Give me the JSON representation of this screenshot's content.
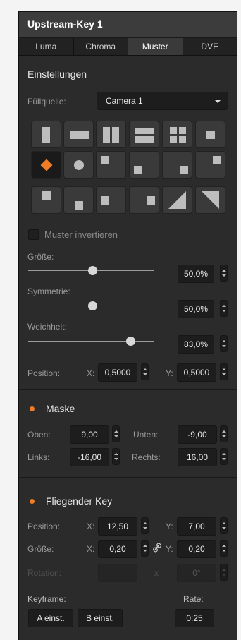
{
  "title": "Upstream-Key 1",
  "tabs": [
    {
      "label": "Luma"
    },
    {
      "label": "Chroma"
    },
    {
      "label": "Muster"
    },
    {
      "label": "DVE"
    }
  ],
  "settings": {
    "heading": "Einstellungen",
    "fill_source_label": "Füllquelle:",
    "fill_source_value": "Camera 1",
    "invert_label": "Muster invertieren",
    "invert_checked": false,
    "size": {
      "label": "Größe:",
      "value": "50,0%",
      "level": 0.5
    },
    "symmetry": {
      "label": "Symmetrie:",
      "value": "50,0%",
      "level": 0.5
    },
    "softness": {
      "label": "Weichheit:",
      "value": "83,0%",
      "level": 0.83
    },
    "position": {
      "label": "Position:",
      "x_label": "X:",
      "x_value": "0,5000",
      "y_label": "Y:",
      "y_value": "0,5000"
    }
  },
  "patterns": {
    "selected_index": 6,
    "items": [
      "left-box-icon",
      "horizontal-bar-icon",
      "vertical-split-icon",
      "horizontal-split-icon",
      "four-box-icon",
      "center-box-icon",
      "diamond-iris-icon",
      "circle-iris-icon",
      "top-left-box-icon",
      "bottom-left-box-icon",
      "bottom-right-box-icon",
      "top-right-box-icon",
      "top-left-corner-icon",
      "bottom-center-icon",
      "center-square-icon",
      "right-center-icon",
      "diagonal-left-icon",
      "diagonal-right-icon"
    ]
  },
  "mask": {
    "label": "Maske",
    "top_label": "Oben:",
    "top_value": "9,00",
    "bottom_label": "Unten:",
    "bottom_value": "-9,00",
    "left_label": "Links:",
    "left_value": "-16,00",
    "right_label": "Rechts:",
    "right_value": "16,00"
  },
  "flying_key": {
    "label": "Fliegender Key",
    "position_label": "Position:",
    "pos_x_label": "X:",
    "pos_x_value": "12,50",
    "pos_y_label": "Y:",
    "pos_y_value": "7,00",
    "size_label": "Größe:",
    "size_x_label": "X:",
    "size_x_value": "0,20",
    "size_y_label": "Y:",
    "size_y_value": "0,20",
    "rotation_label": "Rotation:",
    "rotation_x_label": "x",
    "rotation_value": "0°",
    "keyframe_label": "Keyframe:",
    "a_button": "A einst.",
    "b_button": "B einst.",
    "rate_label": "Rate:",
    "rate_value": "0:25"
  },
  "colors": {
    "accent": "#f07c28",
    "panel": "#2b2b2b",
    "field": "#1d1d1d"
  }
}
